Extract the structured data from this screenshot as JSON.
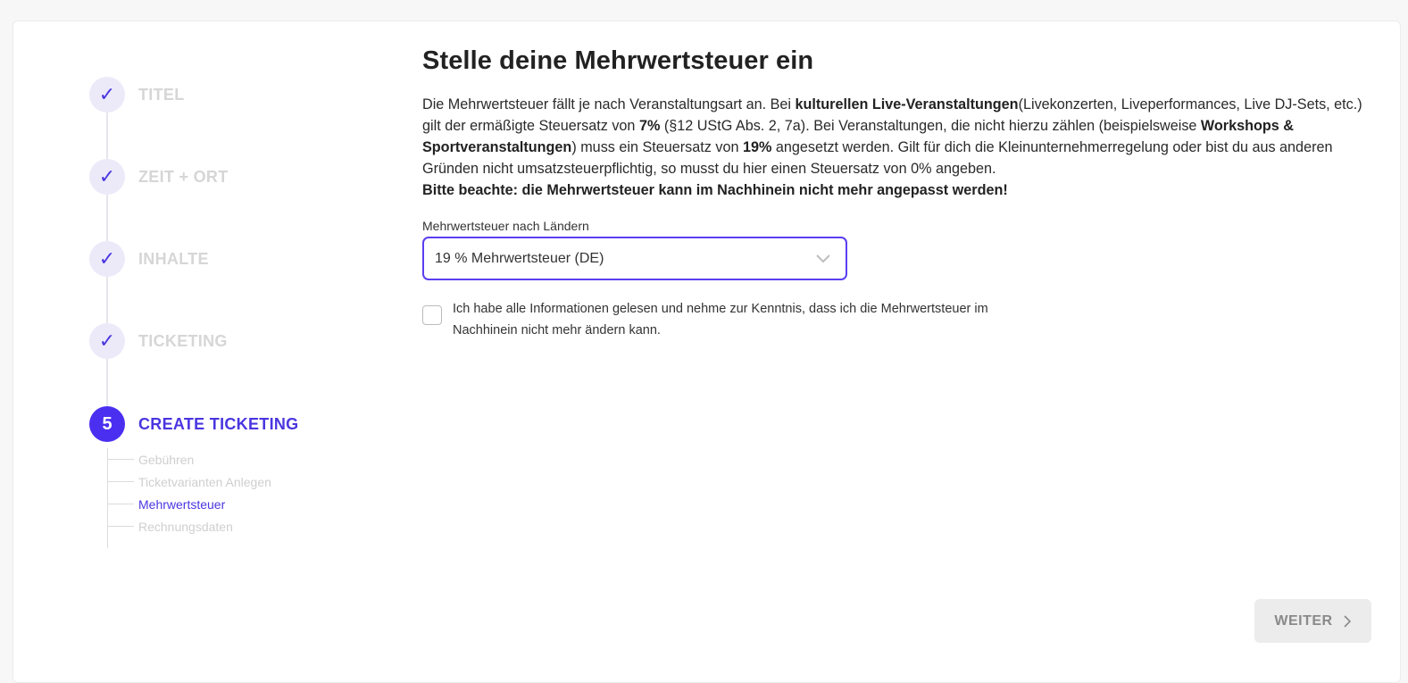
{
  "stepper": {
    "steps": [
      {
        "marker": "✓",
        "label": "TITEL"
      },
      {
        "marker": "✓",
        "label": "ZEIT + ORT"
      },
      {
        "marker": "✓",
        "label": "INHALTE"
      },
      {
        "marker": "✓",
        "label": "TICKETING"
      },
      {
        "marker": "5",
        "label": "CREATE TICKETING"
      }
    ],
    "substeps": [
      "Gebühren",
      "Ticketvarianten Anlegen",
      "Mehrwertsteuer",
      "Rechnungsdaten"
    ],
    "current_substep": "Mehrwertsteuer"
  },
  "main": {
    "title": "Stelle deine Mehrwertsteuer ein",
    "desc": {
      "p1": "Die Mehrwertsteuer fällt je nach Veranstaltungsart an. Bei ",
      "b1": "kulturellen Live-Veranstaltungen",
      "p2": "(Livekonzerten, Liveperformances, Live DJ-Sets, etc.) gilt der ermäßigte Steuersatz von ",
      "b2": "7%",
      "p3": " (§12 UStG Abs. 2, 7a). Bei Veranstaltungen, die nicht hierzu zählen (beispielsweise ",
      "b3": "Workshops & Sportveranstaltungen",
      "p4": ") muss ein Steuersatz von ",
      "b4": "19%",
      "p5": " angesetzt werden. Gilt für dich die Kleinunternehmerregelung oder bist du aus anderen Gründen nicht umsatzsteuerpflichtig, so musst du hier einen Steuersatz von 0% angeben.",
      "b5": "Bitte beachte: die Mehrwertsteuer kann im Nachhinein nicht mehr angepasst werden!"
    },
    "vat_field": {
      "label": "Mehrwertsteuer nach Ländern",
      "selected": "19 % Mehrwertsteuer (DE)"
    },
    "consent": {
      "checked": false,
      "text": "Ich habe alle Informationen gelesen und nehme zur Kenntnis, dass ich die Mehrwertsteuer im Nachhinein nicht mehr ändern kann."
    }
  },
  "footer": {
    "next_label": "WEITER"
  },
  "colors": {
    "accent": "#4a2ff0",
    "step_done_bg": "#eceaf9",
    "muted": "#d6d6d6"
  }
}
